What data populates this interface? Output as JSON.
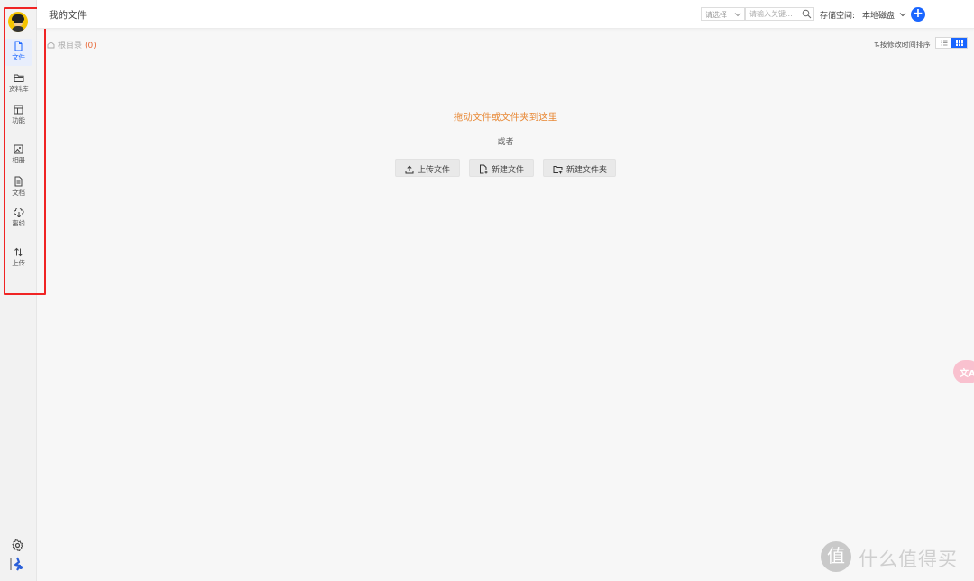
{
  "sidebar": {
    "items": [
      {
        "label": "文件",
        "icon": "file-icon",
        "active": true
      },
      {
        "label": "资料库",
        "icon": "folder-icon"
      },
      {
        "label": "功能",
        "icon": "layout-icon"
      },
      {
        "label": "相册",
        "icon": "image-icon"
      },
      {
        "label": "文档",
        "icon": "document-icon"
      },
      {
        "label": "离线",
        "icon": "cloud-download-icon"
      },
      {
        "label": "上传",
        "icon": "transfer-icon"
      }
    ],
    "bottom_icons": [
      "settings-icon",
      "app-logo-icon"
    ]
  },
  "header": {
    "title": "我的文件",
    "filter_select": {
      "placeholder": "请选择"
    },
    "search": {
      "placeholder": "请输入关键..."
    },
    "storage_label": "存储空间:",
    "storage_value": "本地磁盘",
    "add_label": "+"
  },
  "toolbar": {
    "breadcrumb_root": "根目录",
    "file_count": "(0)",
    "sort_label": "⇅按修改时间排序",
    "view_mode": "grid"
  },
  "empty_state": {
    "drop_hint": "拖动文件或文件夹到这里",
    "or_text": "或者",
    "upload_button": "上传文件",
    "new_file_button": "新建文件",
    "new_folder_button": "新建文件夹"
  },
  "floating": {
    "translate_label": "文A"
  },
  "watermark": {
    "logo": "值",
    "text": "什么值得买"
  },
  "colors": {
    "accent": "#1a66ff",
    "highlight_frame": "#f02424",
    "drop_hint": "#e88a38",
    "file_count": "#e86a3a"
  }
}
